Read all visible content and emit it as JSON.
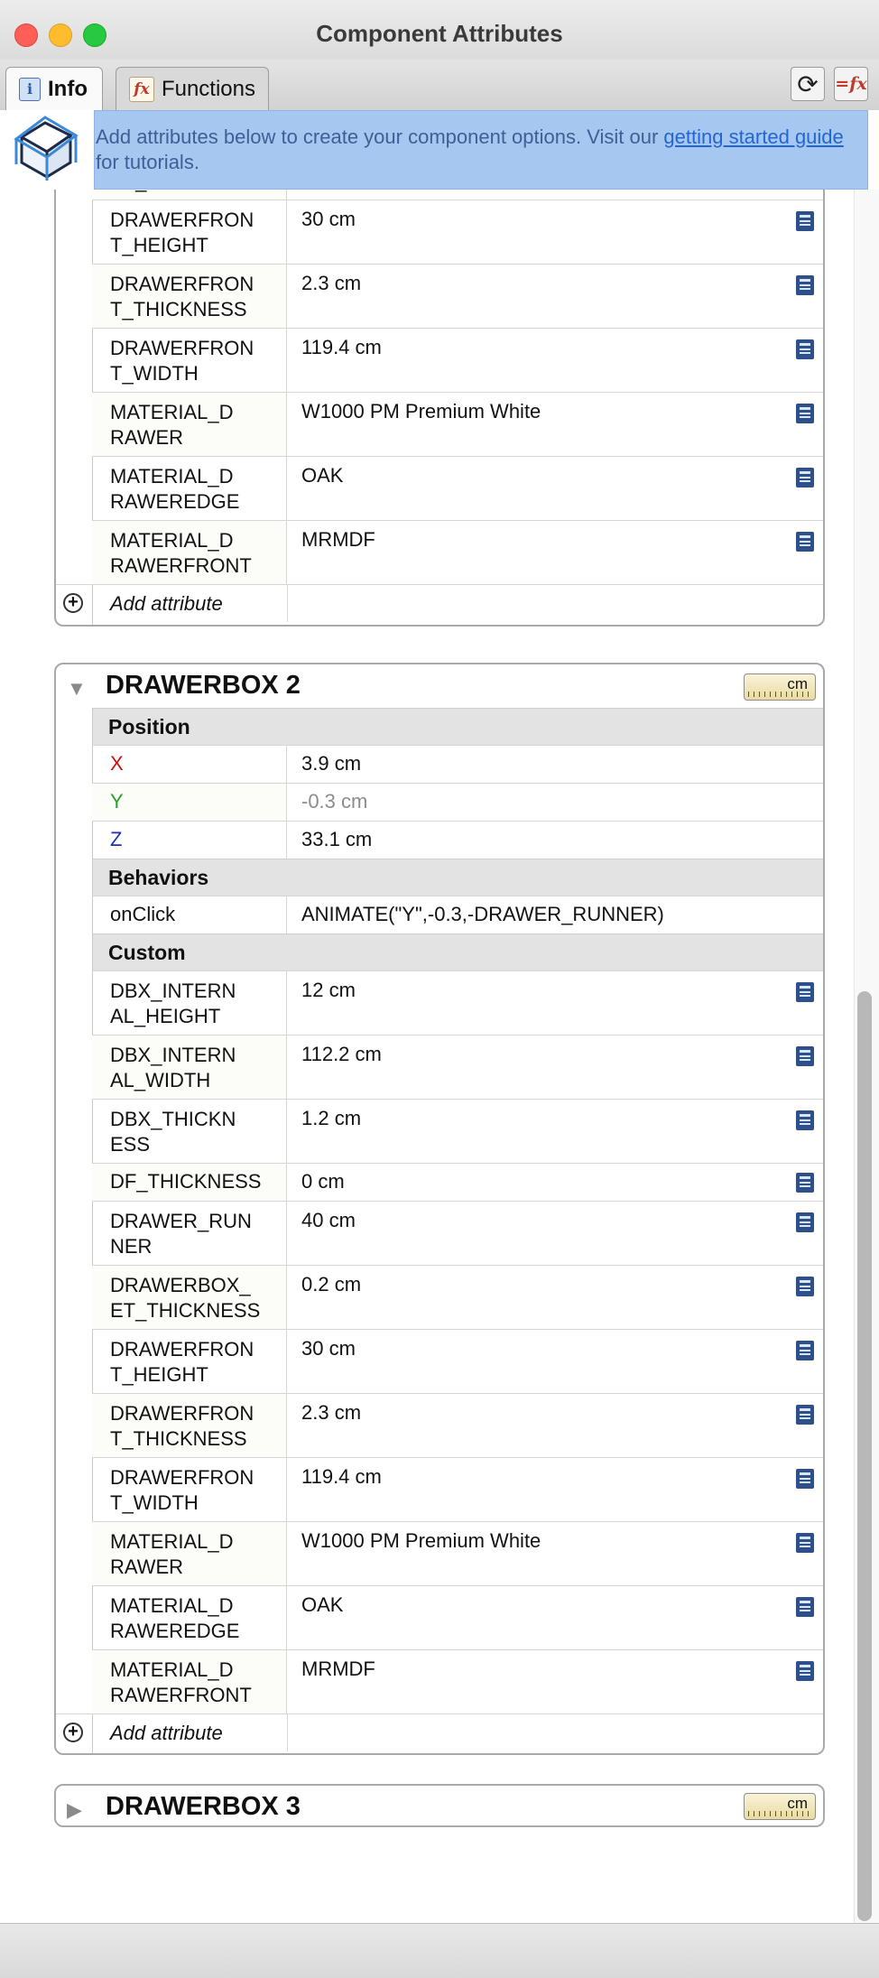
{
  "window": {
    "title": "Component Attributes"
  },
  "tabs": [
    {
      "label": "Info",
      "icon": "info-icon"
    },
    {
      "label": "Functions",
      "icon": "fx-icon"
    }
  ],
  "toolbar": {
    "refresh_icon": "refresh-icon",
    "formula_label": "=fx"
  },
  "banner": {
    "text_before": "Add attributes below to create your component options. Visit our ",
    "link_text": "getting started guide",
    "text_after": " for tutorials."
  },
  "box1": {
    "partial_key": "ET_THICKNESS",
    "rows": [
      {
        "key": "DRAWERFRON\nT_HEIGHT",
        "value": "30 cm"
      },
      {
        "key": "DRAWERFRON\nT_THICKNESS",
        "value": "2.3 cm"
      },
      {
        "key": "DRAWERFRON\nT_WIDTH",
        "value": "119.4 cm"
      },
      {
        "key": "MATERIAL_D\nRAWER",
        "value": "W1000 PM Premium White"
      },
      {
        "key": "MATERIAL_D\nRAWEREDGE",
        "value": "OAK"
      },
      {
        "key": "MATERIAL_D\nRAWERFRONT",
        "value": "MRMDF"
      }
    ],
    "add_label": "Add attribute"
  },
  "box2": {
    "title": "DRAWERBOX 2",
    "unit": "cm",
    "position_label": "Position",
    "position": [
      {
        "key": "X",
        "value": "3.9 cm"
      },
      {
        "key": "Y",
        "value": "-0.3 cm"
      },
      {
        "key": "Z",
        "value": "33.1 cm"
      }
    ],
    "behaviors_label": "Behaviors",
    "behaviors": [
      {
        "key": "onClick",
        "value": "ANIMATE(\"Y\",-0.3,-DRAWER_RUNNER)"
      }
    ],
    "custom_label": "Custom",
    "custom": [
      {
        "key": "DBX_INTERN\nAL_HEIGHT",
        "value": "12 cm"
      },
      {
        "key": "DBX_INTERN\nAL_WIDTH",
        "value": "112.2 cm"
      },
      {
        "key": "DBX_THICKN\nESS",
        "value": "1.2 cm"
      },
      {
        "key": "DF_THICKNESS",
        "value": "0 cm"
      },
      {
        "key": "DRAWER_RUN\nNER",
        "value": "40 cm"
      },
      {
        "key": "DRAWERBOX_\nET_THICKNESS",
        "value": "0.2 cm"
      },
      {
        "key": "DRAWERFRON\nT_HEIGHT",
        "value": "30 cm"
      },
      {
        "key": "DRAWERFRON\nT_THICKNESS",
        "value": "2.3 cm"
      },
      {
        "key": "DRAWERFRON\nT_WIDTH",
        "value": "119.4 cm"
      },
      {
        "key": "MATERIAL_D\nRAWER",
        "value": "W1000 PM Premium White"
      },
      {
        "key": "MATERIAL_D\nRAWEREDGE",
        "value": "OAK"
      },
      {
        "key": "MATERIAL_D\nRAWERFRONT",
        "value": "MRMDF"
      }
    ],
    "add_label": "Add attribute"
  },
  "box3": {
    "title": "DRAWERBOX 3",
    "unit": "cm"
  }
}
